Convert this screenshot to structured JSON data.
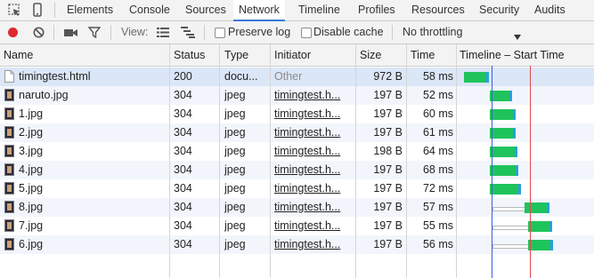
{
  "tabs": [
    {
      "label": "Elements",
      "active": false
    },
    {
      "label": "Console",
      "active": false
    },
    {
      "label": "Sources",
      "active": false
    },
    {
      "label": "Network",
      "active": true
    },
    {
      "label": "Timeline",
      "active": false
    },
    {
      "label": "Profiles",
      "active": false
    },
    {
      "label": "Resources",
      "active": false
    },
    {
      "label": "Security",
      "active": false
    },
    {
      "label": "Audits",
      "active": false
    }
  ],
  "toolbar": {
    "view_label": "View:",
    "preserve_log": {
      "label": "Preserve log",
      "checked": false
    },
    "disable_cache": {
      "label": "Disable cache",
      "checked": false
    },
    "throttling": "No throttling"
  },
  "columns": {
    "name": "Name",
    "status": "Status",
    "type": "Type",
    "initiator": "Initiator",
    "size": "Size",
    "time": "Time",
    "timeline": "Timeline – Start Time"
  },
  "rows": [
    {
      "name": "timingtest.html",
      "status": "200",
      "type": "docu...",
      "initiator": "Other",
      "size": "972 B",
      "time": "58 ms",
      "icon": "html-file-icon",
      "selected": true,
      "wait": 0.0,
      "start": 0.05,
      "dur": 0.33
    },
    {
      "name": "naruto.jpg",
      "status": "304",
      "type": "jpeg",
      "initiator": "timingtest.h...",
      "size": "197 B",
      "time": "52 ms",
      "icon": "image-file-icon",
      "selected": false,
      "wait": 0.0,
      "start": 0.28,
      "dur": 0.28
    },
    {
      "name": "1.jpg",
      "status": "304",
      "type": "jpeg",
      "initiator": "timingtest.h...",
      "size": "197 B",
      "time": "60 ms",
      "icon": "image-file-icon",
      "selected": false,
      "wait": 0.0,
      "start": 0.28,
      "dur": 0.33
    },
    {
      "name": "2.jpg",
      "status": "304",
      "type": "jpeg",
      "initiator": "timingtest.h...",
      "size": "197 B",
      "time": "61 ms",
      "icon": "image-file-icon",
      "selected": false,
      "wait": 0.0,
      "start": 0.28,
      "dur": 0.34
    },
    {
      "name": "3.jpg",
      "status": "304",
      "type": "jpeg",
      "initiator": "timingtest.h...",
      "size": "198 B",
      "time": "64 ms",
      "icon": "image-file-icon",
      "selected": false,
      "wait": 0.0,
      "start": 0.28,
      "dur": 0.36
    },
    {
      "name": "4.jpg",
      "status": "304",
      "type": "jpeg",
      "initiator": "timingtest.h...",
      "size": "197 B",
      "time": "68 ms",
      "icon": "image-file-icon",
      "selected": false,
      "wait": 0.0,
      "start": 0.28,
      "dur": 0.38
    },
    {
      "name": "5.jpg",
      "status": "304",
      "type": "jpeg",
      "initiator": "timingtest.h...",
      "size": "197 B",
      "time": "72 ms",
      "icon": "image-file-icon",
      "selected": false,
      "wait": 0.0,
      "start": 0.28,
      "dur": 0.41
    },
    {
      "name": "8.jpg",
      "status": "304",
      "type": "jpeg",
      "initiator": "timingtest.h...",
      "size": "197 B",
      "time": "57 ms",
      "icon": "image-file-icon",
      "selected": false,
      "wait": 0.3,
      "start": 0.58,
      "dur": 0.32
    },
    {
      "name": "7.jpg",
      "status": "304",
      "type": "jpeg",
      "initiator": "timingtest.h...",
      "size": "197 B",
      "time": "55 ms",
      "icon": "image-file-icon",
      "selected": false,
      "wait": 0.3,
      "start": 0.61,
      "dur": 0.31
    },
    {
      "name": "6.jpg",
      "status": "304",
      "type": "jpeg",
      "initiator": "timingtest.h...",
      "size": "197 B",
      "time": "56 ms",
      "icon": "image-file-icon",
      "selected": false,
      "wait": 0.3,
      "start": 0.61,
      "dur": 0.32
    }
  ],
  "colors": {
    "record": "#e0282f",
    "timing_bar": "#1ec45b",
    "timing_tail": "#2a9fe0",
    "dom_content_loaded": "#3b5fd8",
    "load_event": "#e04a4a",
    "tab_underline": "#3879d9"
  },
  "markers": {
    "dom_content_loaded": 0.295,
    "load_event": 0.56
  }
}
